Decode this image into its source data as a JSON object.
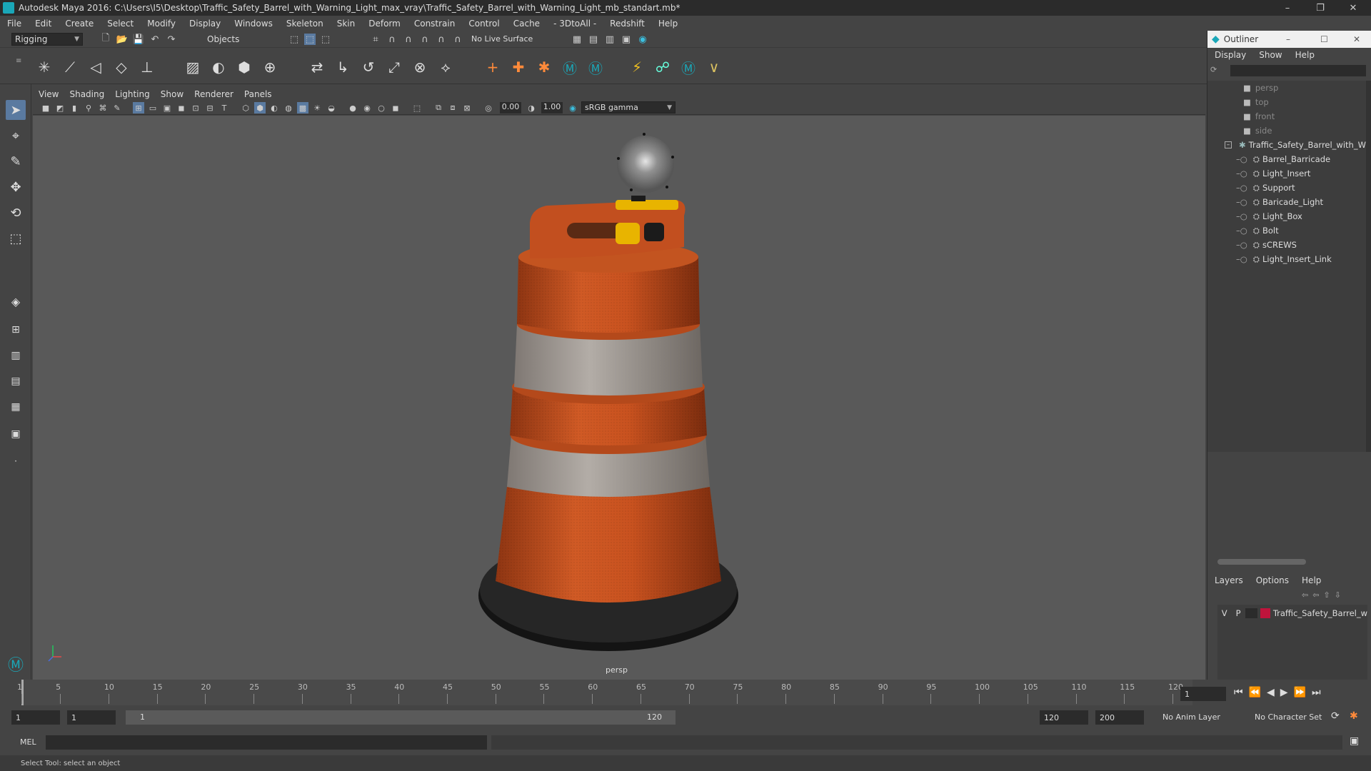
{
  "window": {
    "title": "Autodesk Maya 2016: C:\\Users\\I5\\Desktop\\Traffic_Safety_Barrel_with_Warning_Light_max_vray\\Traffic_Safety_Barrel_with_Warning_Light_mb_standart.mb*",
    "minimize": "–",
    "restore": "❐",
    "close": "✕"
  },
  "menubar": [
    "File",
    "Edit",
    "Create",
    "Select",
    "Modify",
    "Display",
    "Windows",
    "Skeleton",
    "Skin",
    "Deform",
    "Constrain",
    "Control",
    "Cache",
    "- 3DtoAll -",
    "Redshift",
    "Help"
  ],
  "statusline": {
    "mode": "Rigging",
    "selection_mask": "Objects",
    "live_surface": "No Live Surface"
  },
  "viewport": {
    "menu": [
      "View",
      "Shading",
      "Lighting",
      "Show",
      "Renderer",
      "Panels"
    ],
    "exposure": "0.00",
    "gamma": "1.00",
    "color_space": "sRGB gamma",
    "camera_label": "persp"
  },
  "outliner": {
    "title": "Outliner",
    "menu": [
      "Display",
      "Show",
      "Help"
    ],
    "cameras": [
      "persp",
      "top",
      "front",
      "side"
    ],
    "group": "Traffic_Safety_Barrel_with_W",
    "children": [
      "Barrel_Barricade",
      "Light_Insert",
      "Support",
      "Baricade_Light",
      "Light_Box",
      "Bolt",
      "sCREWS",
      "Light_Insert_Link"
    ]
  },
  "layers": {
    "menu": [
      "Layers",
      "Options",
      "Help"
    ],
    "visible": "V",
    "playback": "P",
    "layer_name": "Traffic_Safety_Barrel_w",
    "layer_color": "#c0143c"
  },
  "timeline": {
    "ticks": [
      "1",
      "5",
      "10",
      "15",
      "20",
      "25",
      "30",
      "35",
      "40",
      "45",
      "50",
      "55",
      "60",
      "65",
      "70",
      "75",
      "80",
      "85",
      "90",
      "95",
      "100",
      "105",
      "110",
      "115",
      "120"
    ],
    "current_frame": "1"
  },
  "range": {
    "start": "1",
    "current": "1",
    "slider_start": "1",
    "slider_end": "120",
    "end": "120",
    "max": "200",
    "anim_layer": "No Anim Layer",
    "char_set": "No Character Set"
  },
  "command_line": {
    "lang": "MEL"
  },
  "help_line": "Select Tool: select an object",
  "colors": {
    "barrel_orange": "#c9521f",
    "barrel_white": "#a9a39d",
    "base_black": "#1e1e1e",
    "handle_yellow": "#e8b400",
    "maya_teal": "#1aa7b8"
  }
}
